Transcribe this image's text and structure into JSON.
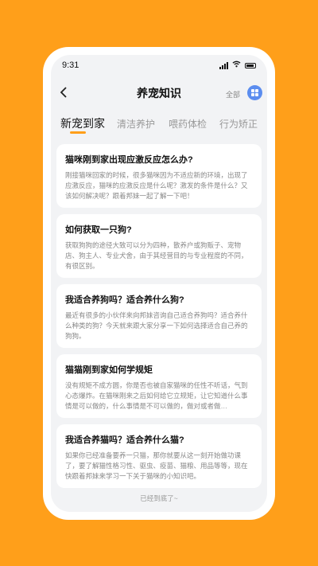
{
  "status": {
    "time": "9:31"
  },
  "header": {
    "title": "养宠知识",
    "all_label": "全部"
  },
  "tabs": [
    "新宠到家",
    "清洁养护",
    "喂药体检",
    "行为矫正"
  ],
  "articles": [
    {
      "title": "猫咪刚到家出现应激反应怎么办?",
      "excerpt": "刚接猫咪回家的时候，很多猫咪因为不适应新的环境，出现了应激反应，猫咪的应激反应是什么呢？激发的条件是什么？又该如何解决呢？跟着邦妹一起了解一下吧！"
    },
    {
      "title": "如何获取一只狗?",
      "excerpt": "获取狗狗的途径大致可以分为四种，散养户或狗贩子、宠物店、狗主人、专业犬舍，由于其经营目的与专业程度的不同，有很区别。"
    },
    {
      "title": "我适合养狗吗？适合养什么狗?",
      "excerpt": "最近有很多的小伙伴来向邦妹咨询自己适合养狗吗？适合养什么种类的狗？今天就来跟大家分享一下如何选择适合自己养的狗狗。"
    },
    {
      "title": "猫猫刚到家如何学规矩",
      "excerpt": "没有规矩不成方圆，你是否也被自家猫咪的任性不听话，气到心态爆炸。在猫咪刚来之后如何给它立规矩，让它知道什么事情是可以做的，什么事情是不可以做的，做对或者做…"
    },
    {
      "title": "我适合养猫吗？适合养什么猫?",
      "excerpt": "如果你已经准备要养一只猫，那你就要从这一刻开始做功课了，要了解猫性格习性、驱虫、疫苗、猫粮、用品等等，现在快跟着邦妹来学习一下关于猫咪的小知识吧。"
    }
  ],
  "footer": "已经到底了~"
}
